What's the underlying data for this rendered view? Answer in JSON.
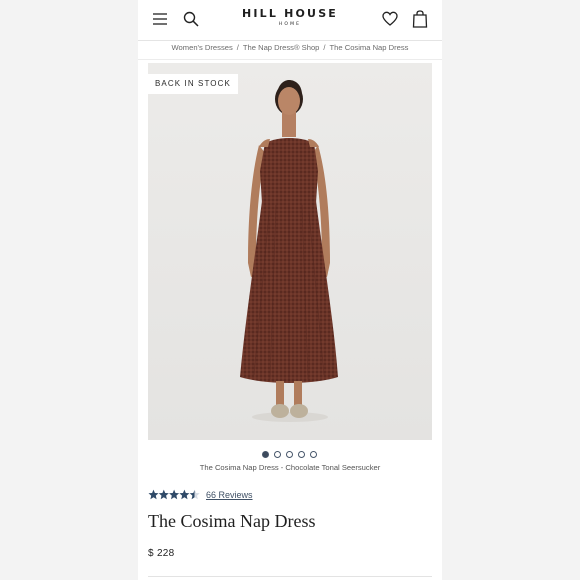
{
  "header": {
    "brand": "HILL HOUSE",
    "brand_sub": "HOME",
    "icons": [
      "menu-icon",
      "search-icon",
      "heart-icon",
      "bag-icon"
    ]
  },
  "breadcrumb": {
    "items": [
      "Women's Dresses",
      "The Nap Dress® Shop",
      "The Cosima Nap Dress"
    ],
    "separator": "/"
  },
  "product": {
    "badge": "BACK IN STOCK",
    "image_caption": "The Cosima Nap Dress - Chocolate Tonal Seersucker",
    "carousel": {
      "total": 5,
      "active": 1
    },
    "rating": {
      "stars": 4.5,
      "max": 5,
      "reviews_label": "66 Reviews"
    },
    "title": "The Cosima Nap Dress",
    "price": "$ 228"
  },
  "colors": {
    "accent": "#2f4a68",
    "dress": "#6a3428",
    "image_bg": "#e9e8e6"
  }
}
